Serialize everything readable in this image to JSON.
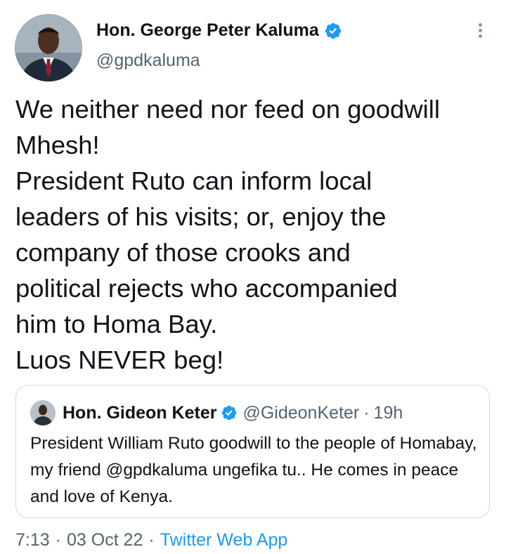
{
  "author": {
    "name": "Hon. George Peter Kaluma",
    "handle": "@gpdkaluma",
    "avatar_icon": "profile-photo",
    "verified": true
  },
  "tweet": {
    "text": "We neither need nor feed on goodwill\nMhesh!\nPresident Ruto can inform local\nleaders of his visits; or, enjoy the\ncompany of those crooks and\npolitical rejects who accompanied\nhim to Homa Bay.\nLuos NEVER beg!"
  },
  "quoted": {
    "name": "Hon. Gideon Keter",
    "handle": "@GideonKeter",
    "separator": "·",
    "time": "19h",
    "text": "President William Ruto goodwill to the people of Homabay, my friend @gpdkaluma ungefika tu.. He comes in peace and love of Kenya.",
    "verified": true
  },
  "footer": {
    "time": "7:13",
    "separator": "·",
    "date": "03 Oct 22",
    "source": "Twitter Web App"
  },
  "colors": {
    "accent": "#1d9bf0",
    "text": "#0f1419",
    "muted": "#536471",
    "border": "#cfd9de"
  }
}
